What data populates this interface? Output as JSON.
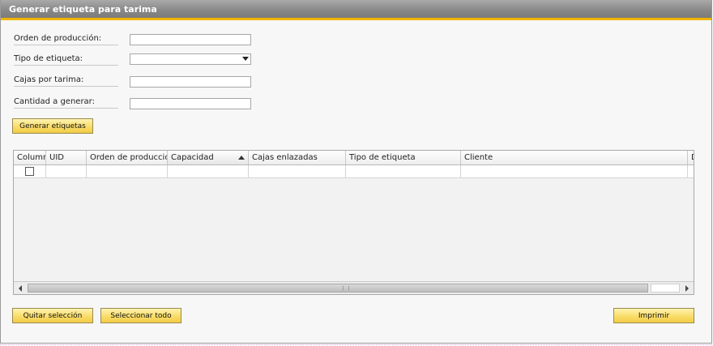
{
  "window": {
    "title": "Generar etiqueta para tarima"
  },
  "form": {
    "orden_label": "Orden de producción:",
    "orden_value": "",
    "tipo_label": "Tipo de etiqueta:",
    "tipo_value": "",
    "cajas_label": "Cajas por tarima:",
    "cajas_value": "",
    "cantidad_label": "Cantidad a generar:",
    "cantidad_value": ""
  },
  "buttons": {
    "generar": "Generar etiquetas",
    "quitar": "Quitar selección",
    "seleccionar": "Seleccionar todo",
    "imprimir": "Imprimir"
  },
  "grid": {
    "columns": [
      "Column",
      "UID",
      "Orden de producción",
      "Capacidad",
      "Cajas enlazadas",
      "Tipo de etiqueta",
      "Cliente",
      "D"
    ],
    "sorted_column": "Capacidad",
    "sort_direction": "ascending",
    "rows": [
      {
        "selected": false,
        "uid": "",
        "orden": "",
        "capacidad": "",
        "cajas": "",
        "tipo": "",
        "cliente": ""
      }
    ]
  },
  "colors": {
    "titlebar": "#878787",
    "accent": "#f0b400",
    "button": "#f9dc6a"
  }
}
